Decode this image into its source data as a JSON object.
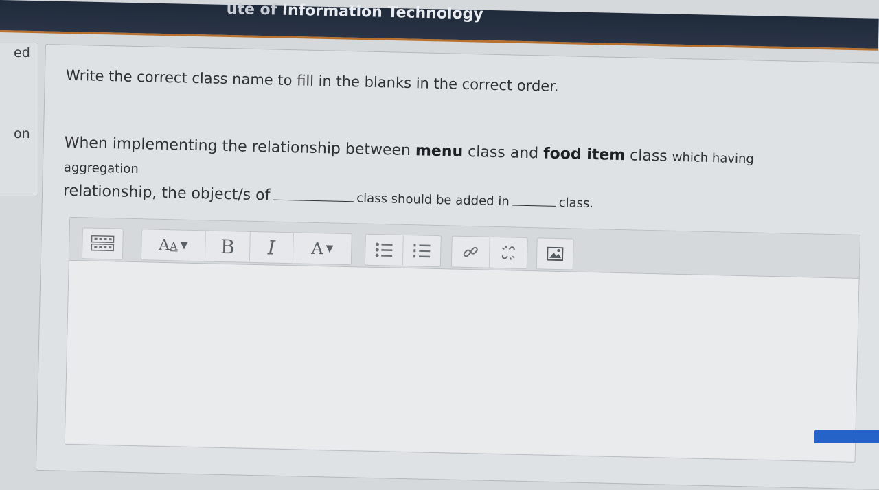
{
  "header": {
    "title_fragment": "ute of ",
    "title_strong": "Information Technology"
  },
  "side": {
    "label_top": "ed",
    "label_bottom": "on"
  },
  "question": {
    "instruction": "Write the correct class name to fill in the blanks in the correct order.",
    "part1": "When implementing the relationship between ",
    "bold1": "menu",
    "part2": " class and ",
    "bold2": "food item",
    "part3": " class ",
    "part4": "which having aggregation",
    "part5": "relationship, the object/s of",
    "part6": "class should be added in",
    "part7": "class."
  },
  "editor": {
    "toolbar": [
      {
        "name": "toggle-toolbar-button",
        "icon": "toolbar-toggle-icon"
      },
      {
        "name": "font-size-button",
        "icon": "font-size-icon"
      },
      {
        "name": "bold-button",
        "label": "B"
      },
      {
        "name": "italic-button",
        "label": "I"
      },
      {
        "name": "text-color-button",
        "label": "A"
      },
      {
        "name": "unordered-list-button",
        "icon": "bullet-list-icon"
      },
      {
        "name": "ordered-list-button",
        "icon": "numbered-list-icon"
      },
      {
        "name": "link-button",
        "icon": "link-icon"
      },
      {
        "name": "unlink-button",
        "icon": "unlink-icon"
      },
      {
        "name": "image-button",
        "icon": "image-icon"
      }
    ]
  },
  "colors": {
    "header_bg": "#1f2a3a",
    "header_accent": "#b8702c",
    "primary_button": "#2563c9"
  }
}
